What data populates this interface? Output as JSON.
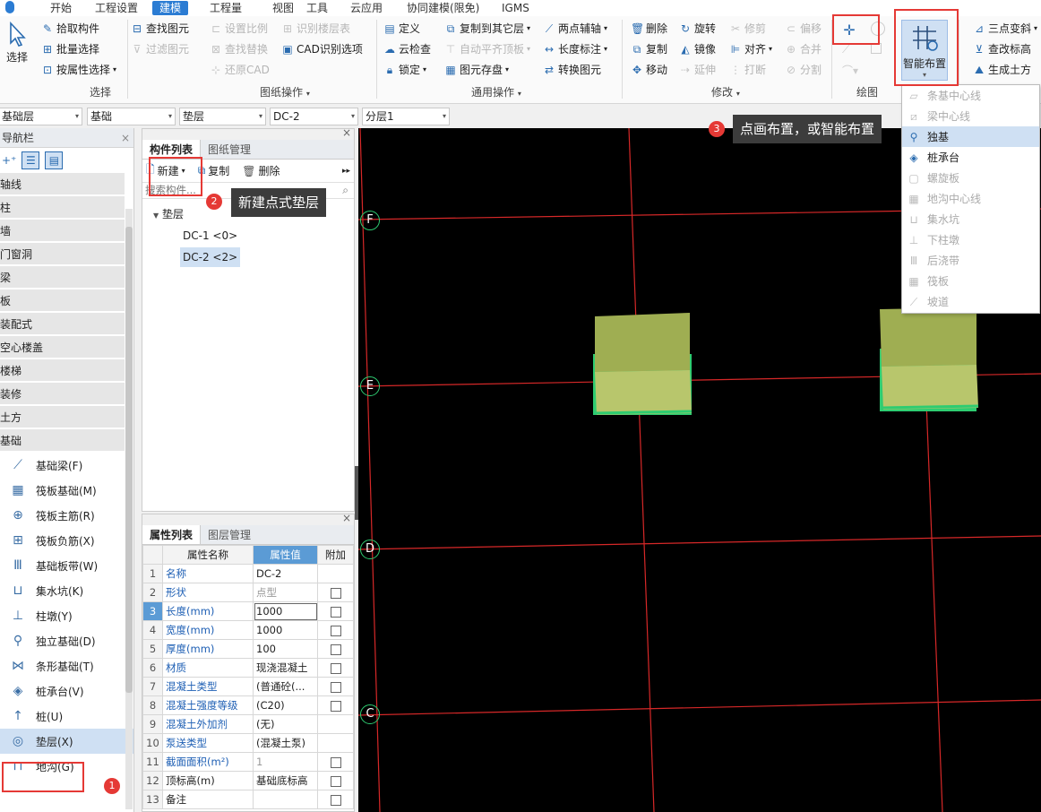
{
  "menubar": {
    "items": [
      "开始",
      "工程设置",
      "建模",
      "工程量",
      "视图",
      "工具",
      "云应用",
      "协同建模(限免)",
      "IGMS"
    ],
    "active": "建模"
  },
  "ribbon": {
    "select_label": "选择",
    "select_group": {
      "items": [
        "拾取构件",
        "批量选择",
        "按属性选择"
      ],
      "group_label": "选择"
    },
    "drawing_group": {
      "col1": [
        "查找图元",
        "过滤图元"
      ],
      "col2": [
        "设置比例",
        "查找替换",
        "还原CAD"
      ],
      "col3": [
        "识别楼层表",
        "CAD识别选项"
      ],
      "group_label": "图纸操作"
    },
    "general_group": {
      "col1": [
        "定义",
        "云检查",
        "锁定"
      ],
      "col2": [
        "复制到其它层",
        "自动平齐顶板",
        "图元存盘"
      ],
      "col3": [
        "两点辅轴",
        "长度标注",
        "转换图元"
      ],
      "group_label": "通用操作"
    },
    "modify_group": {
      "col1": [
        "删除",
        "复制",
        "移动"
      ],
      "col2": [
        "旋转",
        "镜像",
        "延伸"
      ],
      "col3": [
        "修剪",
        "对齐",
        "打断"
      ],
      "col4": [
        "偏移",
        "合并",
        "分割"
      ],
      "group_label": "修改"
    },
    "draw_group": {
      "group_label": "绘图"
    },
    "smart_layout": {
      "label": "智能布置"
    },
    "right_group": {
      "items": [
        "三点变斜",
        "查改标高",
        "生成土方"
      ]
    }
  },
  "combos": [
    "基础层",
    "基础",
    "垫层",
    "DC-2",
    "分层1"
  ],
  "nav": {
    "title": "导航栏",
    "categories": [
      "轴线",
      "柱",
      "墙",
      "门窗洞",
      "梁",
      "板",
      "装配式",
      "空心楼盖",
      "楼梯",
      "装修",
      "土方",
      "基础"
    ],
    "sub_items": [
      {
        "label": "基础梁(F)",
        "icon": "foundation-beam-icon"
      },
      {
        "label": "筏板基础(M)",
        "icon": "raft-foundation-icon"
      },
      {
        "label": "筏板主筋(R)",
        "icon": "raft-main-rebar-icon"
      },
      {
        "label": "筏板负筋(X)",
        "icon": "raft-negative-rebar-icon"
      },
      {
        "label": "基础板带(W)",
        "icon": "foundation-strip-icon"
      },
      {
        "label": "集水坑(K)",
        "icon": "sump-pit-icon"
      },
      {
        "label": "柱墩(Y)",
        "icon": "column-pier-icon"
      },
      {
        "label": "独立基础(D)",
        "icon": "isolated-footing-icon"
      },
      {
        "label": "条形基础(T)",
        "icon": "strip-footing-icon"
      },
      {
        "label": "桩承台(V)",
        "icon": "pile-cap-icon"
      },
      {
        "label": "桩(U)",
        "icon": "pile-icon"
      },
      {
        "label": "垫层(X)",
        "icon": "cushion-layer-icon"
      },
      {
        "label": "地沟(G)",
        "icon": "ditch-icon"
      }
    ],
    "selected": "垫层(X)"
  },
  "component_panel": {
    "tabs": [
      "构件列表",
      "图纸管理"
    ],
    "new_label": "新建",
    "copy_label": "复制",
    "delete_label": "删除",
    "search_placeholder": "搜索构件...",
    "tree_root": "垫层",
    "tree_items": [
      "DC-1 <0>",
      "DC-2 <2>"
    ],
    "selected": "DC-2 <2>"
  },
  "property_panel": {
    "tabs": [
      "属性列表",
      "图层管理"
    ],
    "headers": [
      "属性名称",
      "属性值",
      "附加"
    ],
    "rows": [
      {
        "n": "1",
        "name": "名称",
        "value": "DC-2",
        "check": false
      },
      {
        "n": "2",
        "name": "形状",
        "value": "点型",
        "check": true
      },
      {
        "n": "3",
        "name": "长度(mm)",
        "value": "1000",
        "check": true
      },
      {
        "n": "4",
        "name": "宽度(mm)",
        "value": "1000",
        "check": true
      },
      {
        "n": "5",
        "name": "厚度(mm)",
        "value": "100",
        "check": true
      },
      {
        "n": "6",
        "name": "材质",
        "value": "现浇混凝土",
        "check": true
      },
      {
        "n": "7",
        "name": "混凝土类型",
        "value": "(普通砼(...",
        "check": true
      },
      {
        "n": "8",
        "name": "混凝土强度等级",
        "value": "(C20)",
        "check": true
      },
      {
        "n": "9",
        "name": "混凝土外加剂",
        "value": "(无)",
        "check": false
      },
      {
        "n": "10",
        "name": "泵送类型",
        "value": "(混凝土泵)",
        "check": false
      },
      {
        "n": "11",
        "name": "截面面积(m²)",
        "value": "1",
        "check": true
      },
      {
        "n": "12",
        "name": "顶标高(m)",
        "value": "基础底标高",
        "check": true
      },
      {
        "n": "13",
        "name": "备注",
        "value": "",
        "check": true
      }
    ]
  },
  "dropdown": {
    "items": [
      {
        "label": "条基中心线",
        "enabled": false,
        "icon": "strip-centerline-icon"
      },
      {
        "label": "梁中心线",
        "enabled": false,
        "icon": "beam-centerline-icon"
      },
      {
        "label": "独基",
        "enabled": true,
        "highlight": true,
        "icon": "isolated-footing-icon"
      },
      {
        "label": "桩承台",
        "enabled": true,
        "icon": "pile-cap-icon"
      },
      {
        "label": "螺旋板",
        "enabled": false,
        "icon": "spiral-plate-icon"
      },
      {
        "label": "地沟中心线",
        "enabled": false,
        "icon": "ditch-centerline-icon"
      },
      {
        "label": "集水坑",
        "enabled": false,
        "icon": "sump-pit-icon"
      },
      {
        "label": "下柱墩",
        "enabled": false,
        "icon": "lower-pier-icon"
      },
      {
        "label": "后浇带",
        "enabled": false,
        "icon": "post-cast-strip-icon"
      },
      {
        "label": "筏板",
        "enabled": false,
        "icon": "raft-icon"
      },
      {
        "label": "坡道",
        "enabled": false,
        "icon": "ramp-icon"
      }
    ]
  },
  "canvas": {
    "axis_labels": [
      "F",
      "E",
      "D",
      "C"
    ]
  },
  "annotations": {
    "badge1": "1",
    "badge2": "2",
    "badge3": "3",
    "callout2": "新建点式垫层",
    "callout3": "点画布置，或智能布置"
  },
  "colors": {
    "accent": "#2b7cd3",
    "grid_line": "#e53935",
    "footing_top": "#9fae52",
    "footing_front": "#b8c66c",
    "footing_edge": "#2ecc71"
  }
}
